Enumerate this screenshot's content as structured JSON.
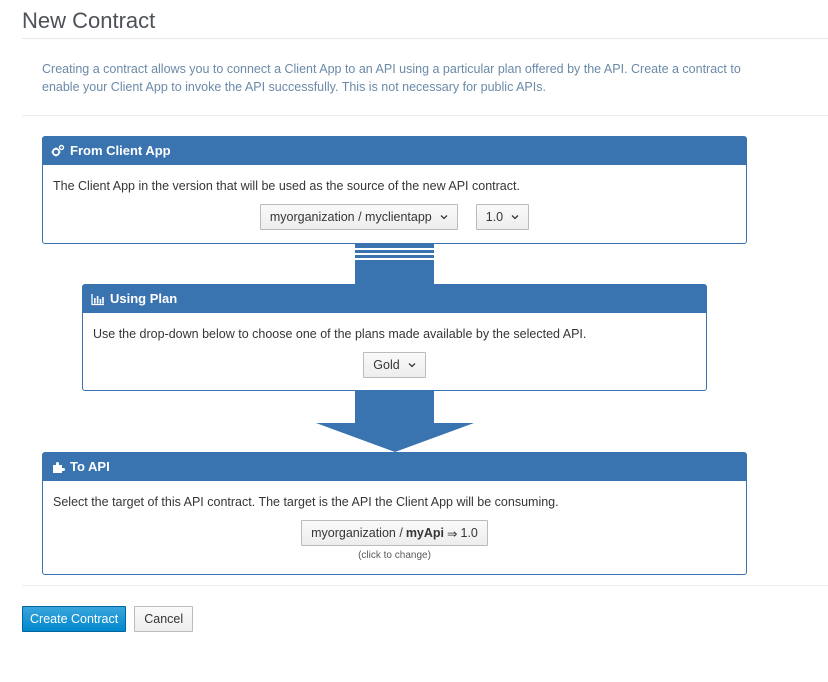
{
  "page": {
    "title": "New Contract",
    "description": "Creating a contract allows you to connect a Client App to an API using a particular plan offered by the API. Create a contract to enable your Client App to invoke the API successfully. This is not necessary for public APIs."
  },
  "client_app": {
    "heading": "From Client App",
    "icon": "gears-icon",
    "text": "The Client App in the version that will be used as the source of the new API contract.",
    "app_value": "myorganization / myclientapp",
    "version_value": "1.0"
  },
  "plan": {
    "heading": "Using Plan",
    "icon": "bar-chart-icon",
    "text": "Use the drop-down below to choose one of the plans made available by the selected API.",
    "plan_value": "Gold"
  },
  "api": {
    "heading": "To API",
    "icon": "puzzle-icon",
    "text": "Select the target of this API contract. The target is the API the Client App will be consuming.",
    "target_org": "myorganization /",
    "target_api": "myApi",
    "target_arrow": "⇒",
    "target_version": "1.0",
    "hint": "(click to change)"
  },
  "actions": {
    "create_label": "Create Contract",
    "cancel_label": "Cancel"
  },
  "colors": {
    "panel_accent": "#3a74b0",
    "primary_button": "#0088ce",
    "description_text": "#6a8aa8"
  }
}
